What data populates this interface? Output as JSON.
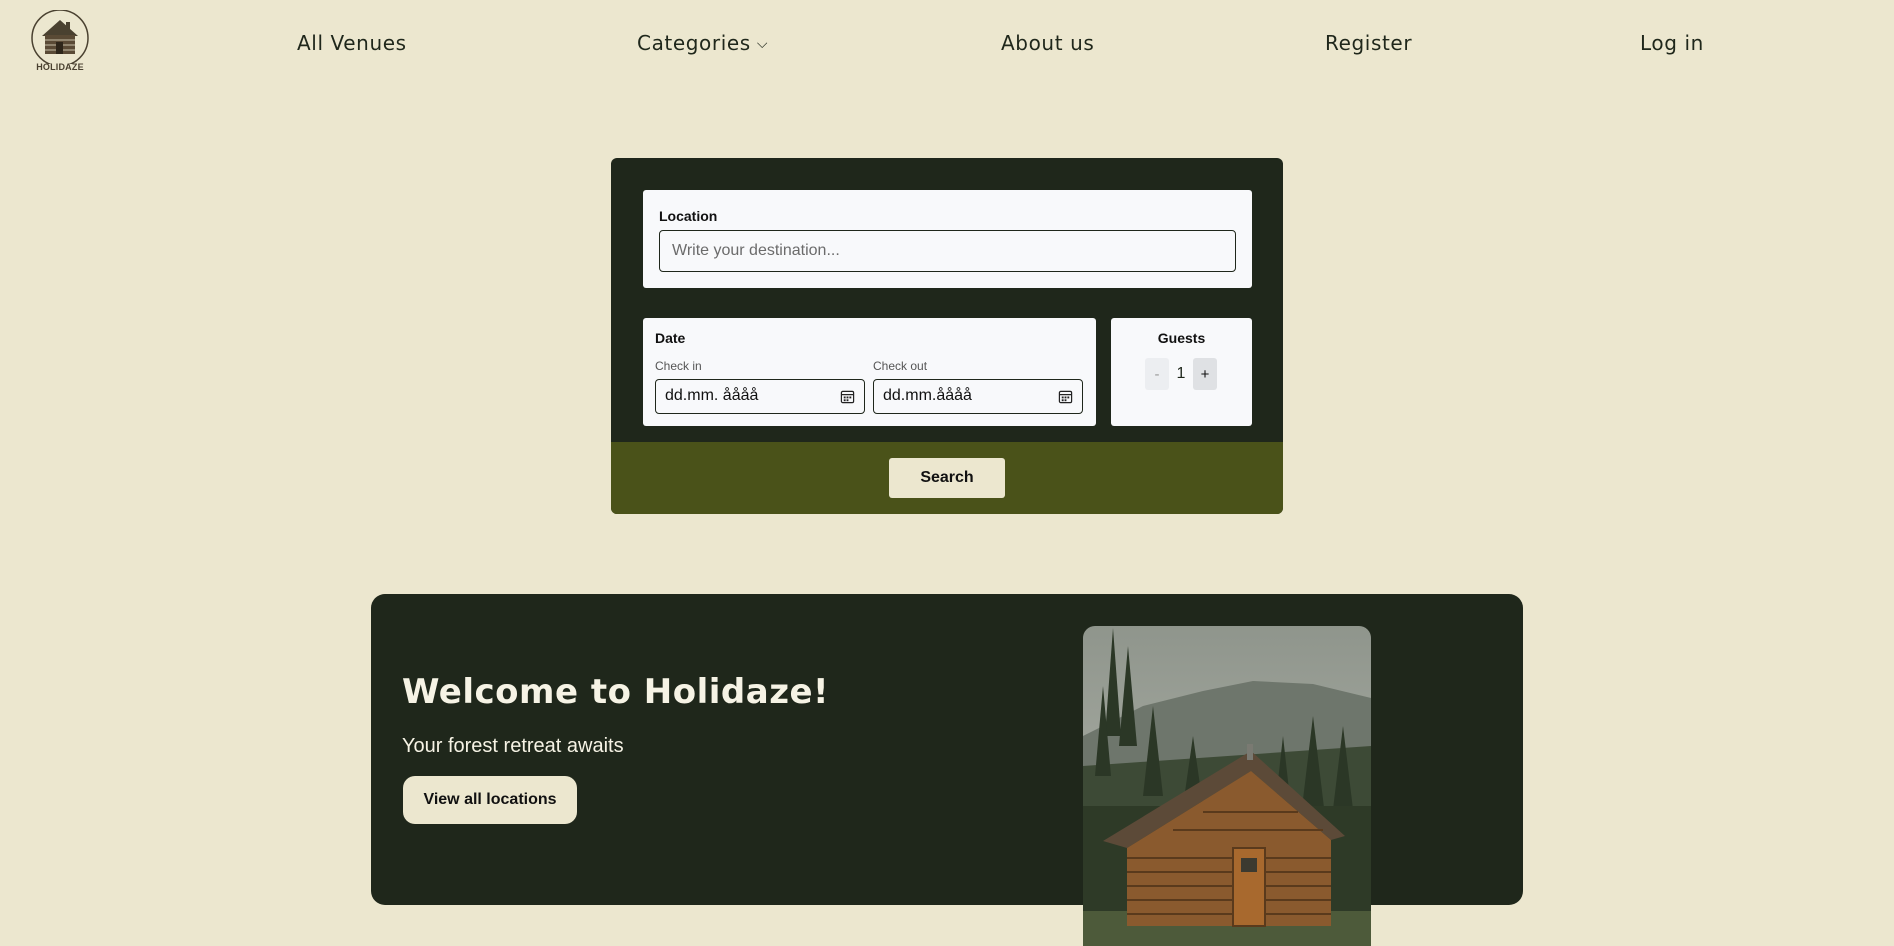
{
  "brand": {
    "logo_text": "HOLIDAZE"
  },
  "nav": {
    "all_venues": "All Venues",
    "categories": "Categories",
    "about": "About us",
    "register": "Register",
    "login": "Log in"
  },
  "search": {
    "location_label": "Location",
    "location_placeholder": "Write your destination...",
    "date_label": "Date",
    "checkin_label": "Check in",
    "checkin_value": "dd.mm. åååå",
    "checkout_label": "Check out",
    "checkout_value": "dd.mm.åååå",
    "guests_label": "Guests",
    "guests_minus": "-",
    "guests_value": "1",
    "guests_plus": "+",
    "search_button": "Search"
  },
  "hero": {
    "title": "Welcome to Holidaze!",
    "subtitle": "Your forest retreat awaits",
    "cta": "View all locations"
  },
  "colors": {
    "background": "#ece7cf",
    "dark_green": "#1f271b",
    "olive": "#4a5219",
    "panel": "#f8f9fb"
  },
  "icons": [
    "cabin-logo-icon",
    "chevron-down-icon",
    "calendar-icon"
  ]
}
